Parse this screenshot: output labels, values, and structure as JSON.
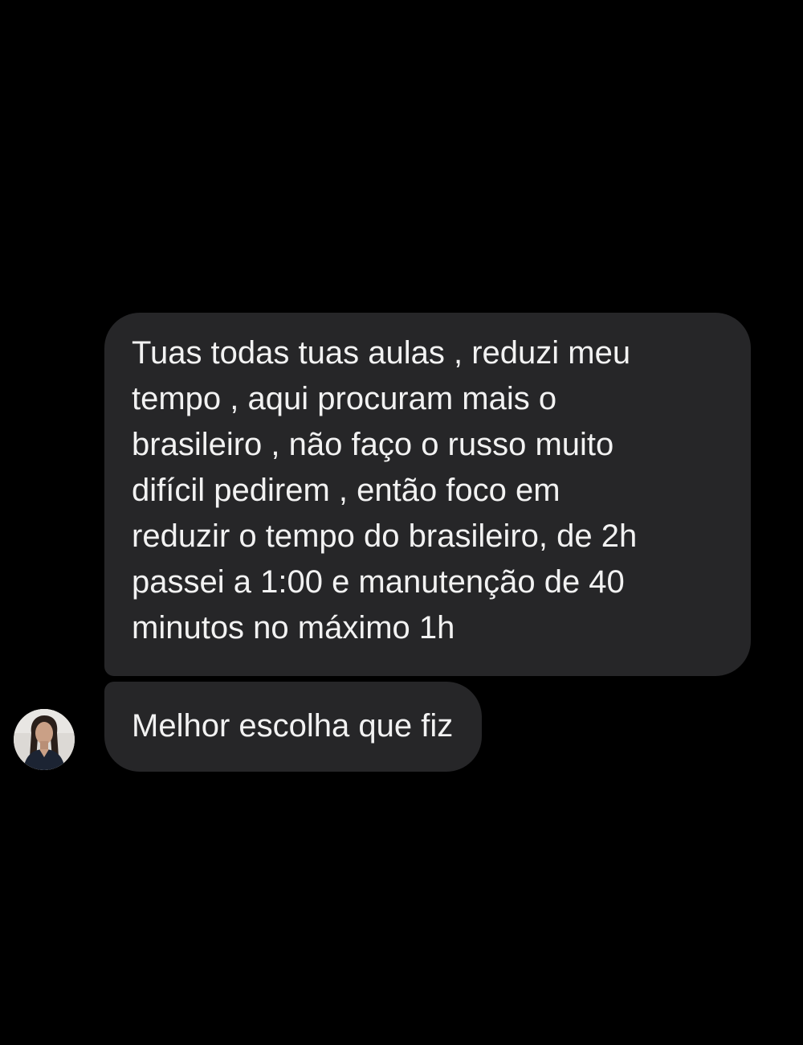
{
  "thread": {
    "messages": [
      {
        "lines": [
          "Tuas todas tuas aulas , reduzi meu",
          "tempo , aqui procuram mais o",
          "brasileiro , não faço o russo muito",
          "difícil pedirem , então foco em",
          "reduzir o tempo do brasileiro, de 2h",
          "passei a 1:00 e manutenção de 40",
          "minutos no máximo 1h"
        ]
      },
      {
        "lines": [
          "Melhor escolha que fiz"
        ]
      }
    ],
    "avatar": {
      "icon": "sender-profile-photo"
    }
  },
  "colors": {
    "background": "#000000",
    "bubble": "#262628",
    "text": "#f2f2f2"
  }
}
